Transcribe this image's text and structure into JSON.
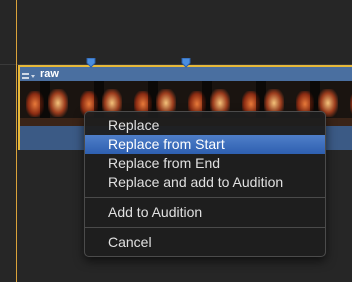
{
  "clip": {
    "name": "raw",
    "icon": "clip-menu-icon"
  },
  "colors": {
    "playhead": "#d9a23a",
    "clip_border": "#e7b93a",
    "clip_header": "#4a6fa0",
    "menu_selected": "#3a6cbf"
  },
  "menu": {
    "items": [
      {
        "label": "Replace"
      },
      {
        "label": "Replace from Start",
        "selected": true
      },
      {
        "label": "Replace from End"
      },
      {
        "label": "Replace and add to Audition"
      },
      {
        "label": "Add to Audition"
      },
      {
        "label": "Cancel"
      }
    ]
  }
}
